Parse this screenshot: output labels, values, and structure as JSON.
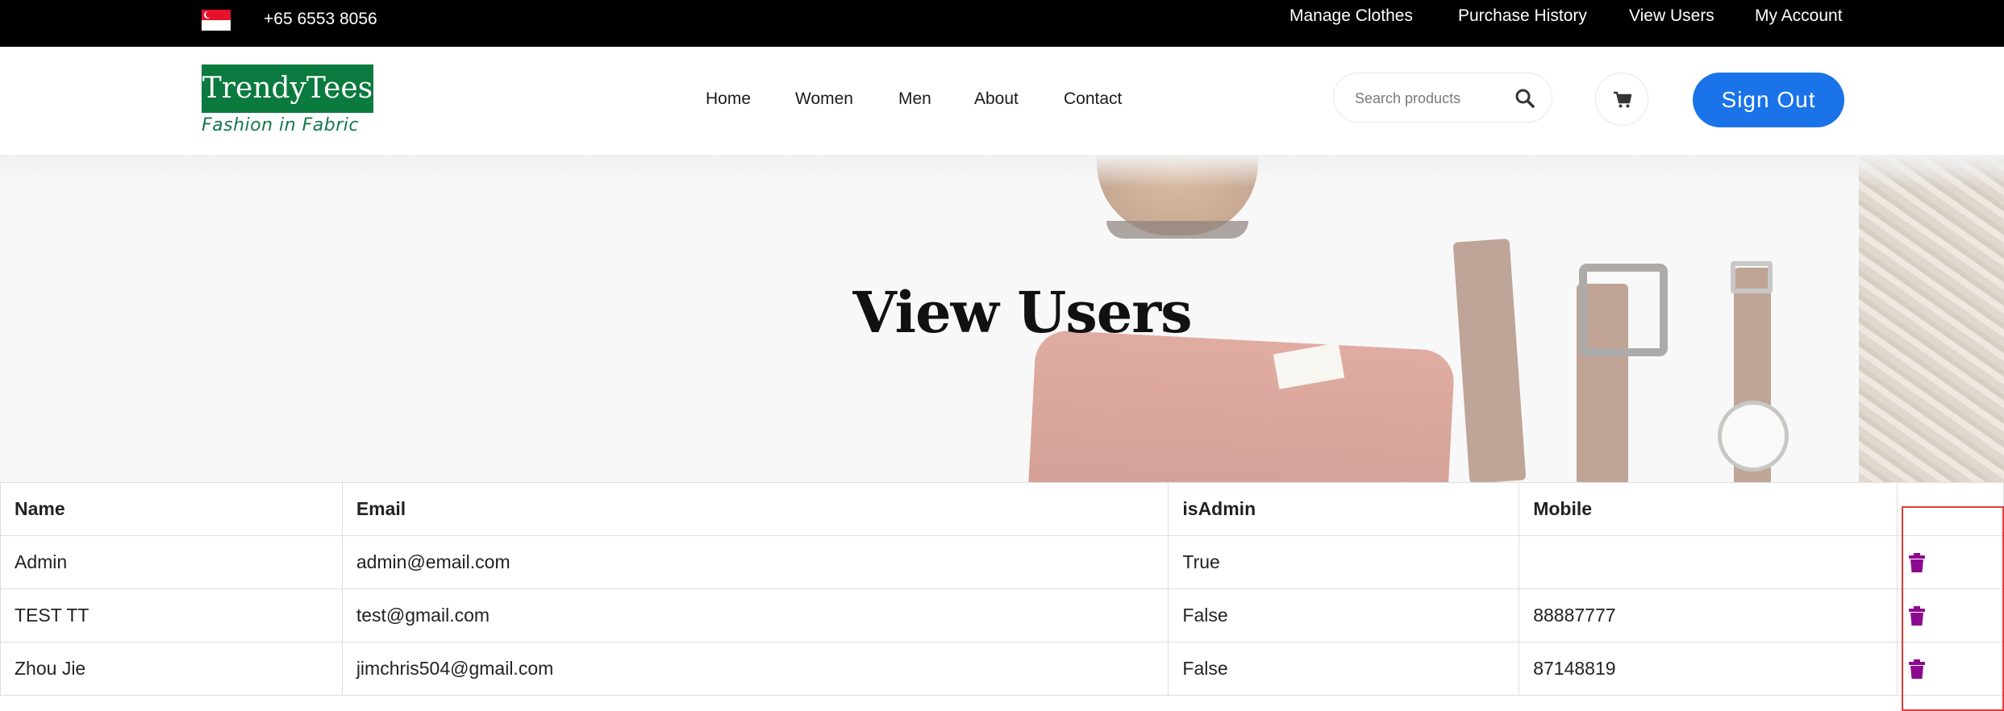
{
  "topbar": {
    "phone": "+65 6553 8056",
    "links": [
      "Manage Clothes",
      "Purchase History",
      "View Users",
      "My Account"
    ]
  },
  "header": {
    "logo_name": "TrendyTees",
    "logo_tagline": "Fashion in Fabric",
    "nav": [
      "Home",
      "Women",
      "Men",
      "About",
      "Contact"
    ],
    "search_placeholder": "Search products",
    "sign_out_label": "Sign Out"
  },
  "hero": {
    "title": "View Users"
  },
  "users_table": {
    "headers": [
      "Name",
      "Email",
      "isAdmin",
      "Mobile",
      ""
    ],
    "rows": [
      {
        "name": "Admin",
        "email": "admin@email.com",
        "is_admin": "True",
        "mobile": ""
      },
      {
        "name": "TEST TT",
        "email": "test@gmail.com",
        "is_admin": "False",
        "mobile": "88887777"
      },
      {
        "name": "Zhou Jie",
        "email": "jimchris504@gmail.com",
        "is_admin": "False",
        "mobile": "87148819"
      }
    ]
  },
  "colors": {
    "topbar_bg": "#000000",
    "brand_green": "#0a7a3e",
    "sign_out_blue": "#1a73e8",
    "trash_purple": "#8b0a8f",
    "highlight_red": "#e23b3b"
  },
  "icons": {
    "flag": "singapore-flag-icon",
    "search": "search-icon",
    "cart": "cart-icon",
    "delete": "trash-icon"
  }
}
